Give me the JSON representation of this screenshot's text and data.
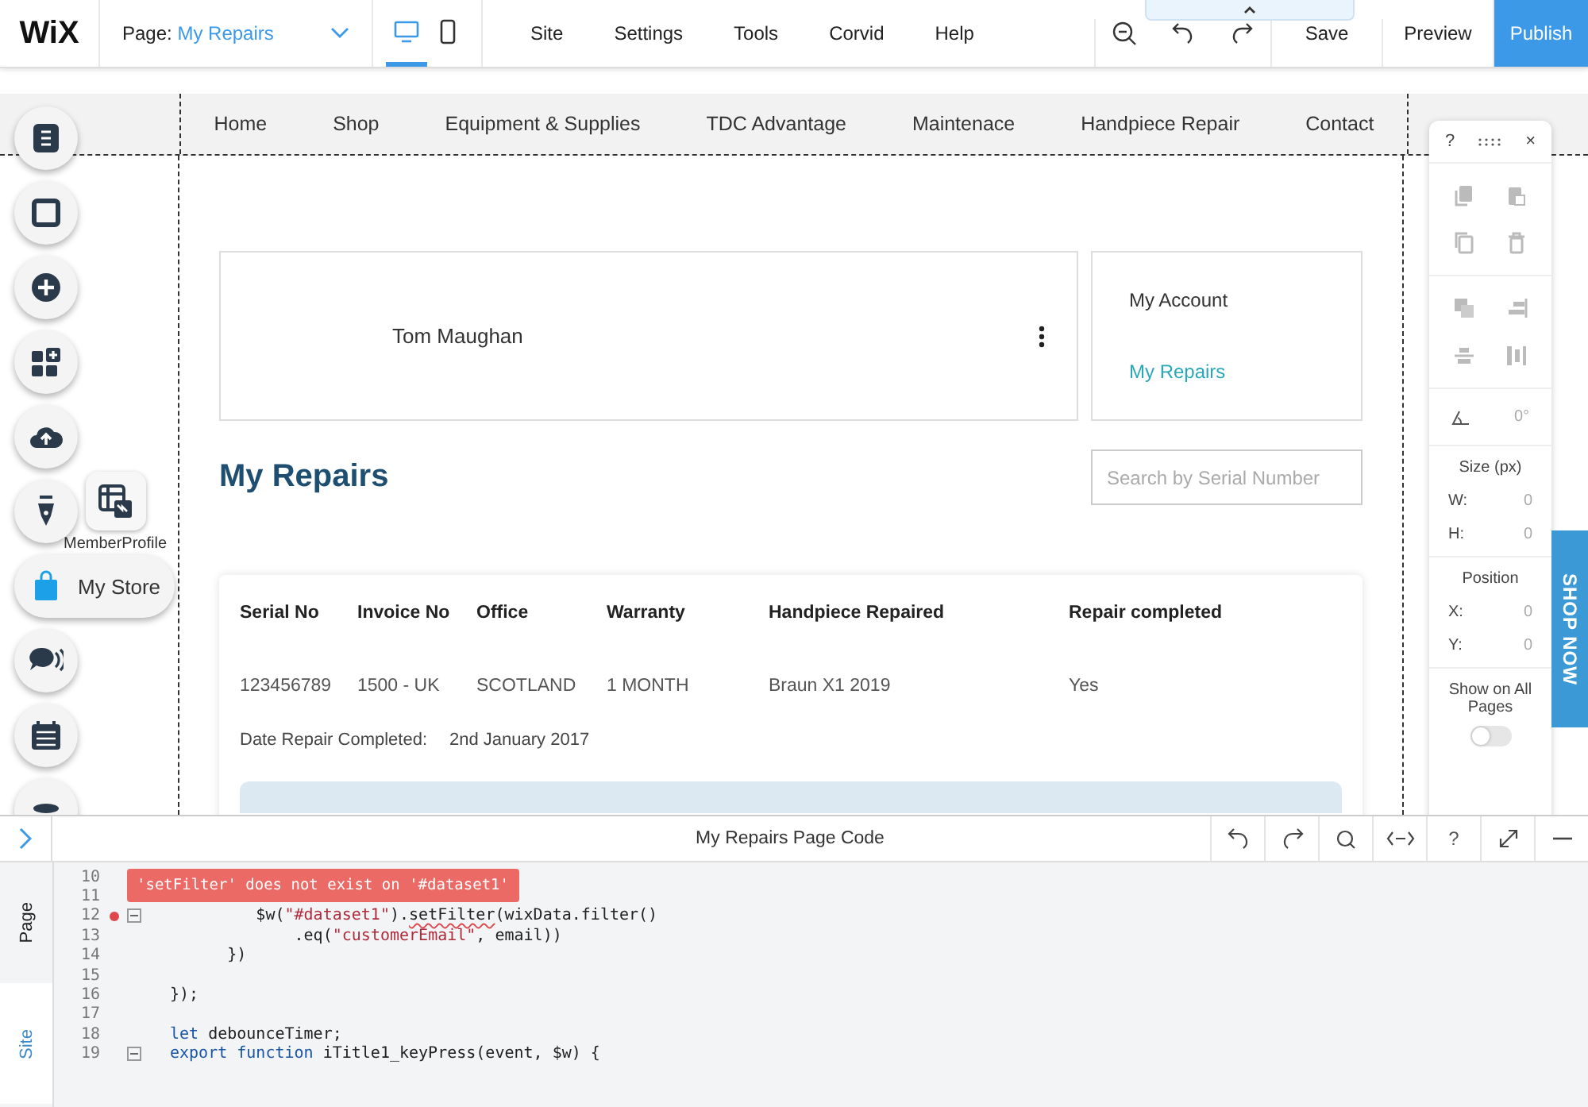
{
  "topbar": {
    "logo": "WiX",
    "page_label": "Page:",
    "page_name": "My Repairs",
    "devices": [
      {
        "kind": "desktop",
        "selected": true
      },
      {
        "kind": "mobile",
        "selected": false
      }
    ],
    "menu": [
      "Site",
      "Settings",
      "Tools",
      "Corvid",
      "Help"
    ],
    "buttons": [
      {
        "label": "Save",
        "kind": "plain"
      },
      {
        "label": "Preview",
        "kind": "plain"
      },
      {
        "label": "Publish",
        "kind": "primary"
      }
    ]
  },
  "site_nav": [
    "Home",
    "Shop",
    "Equipment & Supplies",
    "TDC Advantage",
    "Maintenace",
    "Handpiece Repair",
    "Contact"
  ],
  "profile": {
    "name": "Tom Maughan",
    "menu": [
      {
        "label": "My Account",
        "selected": false
      },
      {
        "label": "My Repairs",
        "selected": true
      }
    ]
  },
  "heading": "My Repairs",
  "search": {
    "placeholder": "Search by Serial Number"
  },
  "table": {
    "columns": [
      "Serial No",
      "Invoice No",
      "Office",
      "Warranty",
      "Handpiece Repaired",
      "Repair completed"
    ],
    "rows": [
      [
        "123456789",
        "1500 - UK",
        "SCOTLAND",
        "1 MONTH",
        "Braun X1 2019",
        "Yes"
      ]
    ],
    "date_label": "Date Repair Completed:",
    "date_value": "2nd January 2017"
  },
  "tools": {
    "member_profile": "MemberProfile",
    "store": "My Store"
  },
  "inspector": {
    "help": "?",
    "close": "×",
    "rotation": "0°",
    "size_title": "Size (px)",
    "size": [
      {
        "label": "W:",
        "value": "0"
      },
      {
        "label": "H:",
        "value": "0"
      }
    ],
    "position_title": "Position",
    "position": [
      {
        "label": "X:",
        "value": "0"
      },
      {
        "label": "Y:",
        "value": "0"
      }
    ],
    "show_all_label": "Show on All Pages",
    "show_all_on": false
  },
  "shop_now": "SHOP NOW",
  "code_panel": {
    "title": "My Repairs Page Code",
    "help": "?",
    "tabs": [
      {
        "label": "Page",
        "selected": true
      },
      {
        "label": "Site",
        "selected": false
      }
    ],
    "error": "'setFilter' does not exist on '#dataset1'",
    "lines": [
      {
        "number": "10"
      },
      {
        "number": "11",
        "fold": false,
        "error": false
      },
      {
        "number": "12",
        "fold": true,
        "error": true,
        "segments": [
          {
            "kind": "plain",
            "text": "         $w("
          },
          {
            "kind": "string",
            "text": "\"#dataset1\""
          },
          {
            "kind": "plain",
            "text": ")."
          },
          {
            "kind": "error",
            "text": "setFilter"
          },
          {
            "kind": "plain",
            "text": "(wixData.filter()"
          }
        ]
      },
      {
        "number": "13",
        "fold": false,
        "error": false,
        "segments": [
          {
            "kind": "plain",
            "text": "             .eq("
          },
          {
            "kind": "string",
            "text": "\"customerEmail\""
          },
          {
            "kind": "plain",
            "text": ", email))"
          }
        ]
      },
      {
        "number": "14",
        "fold": false,
        "error": false,
        "segments": [
          {
            "kind": "plain",
            "text": "      })"
          }
        ]
      },
      {
        "number": "15",
        "fold": false,
        "error": false
      },
      {
        "number": "16",
        "fold": false,
        "error": false,
        "segments": [
          {
            "kind": "plain",
            "text": "});"
          }
        ]
      },
      {
        "number": "17",
        "fold": false,
        "error": false
      },
      {
        "number": "18",
        "fold": false,
        "error": false,
        "segments": [
          {
            "kind": "keyword",
            "text": "let"
          },
          {
            "kind": "plain",
            "text": " debounceTimer;"
          }
        ]
      },
      {
        "number": "19",
        "fold": true,
        "error": false,
        "segments": [
          {
            "kind": "keyword",
            "text": "export function"
          },
          {
            "kind": "plain",
            "text": " iTitle1_keyPress(event, $w) {"
          }
        ]
      }
    ]
  }
}
